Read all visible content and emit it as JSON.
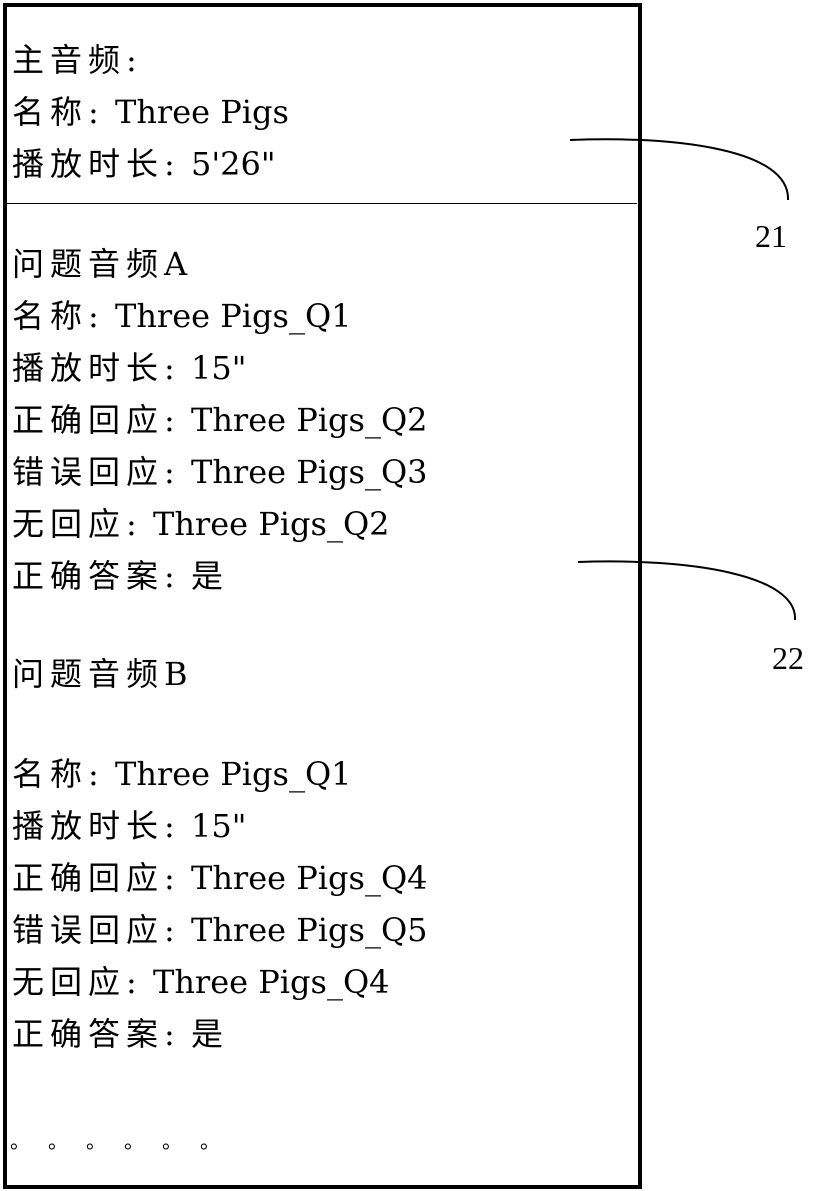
{
  "main_audio": {
    "heading": "主音频:",
    "name_label": "名称:",
    "name_value": "Three Pigs",
    "duration_label": "播放时长:",
    "duration_value": "5'26\""
  },
  "question_a": {
    "heading": "问题音频A",
    "name_label": "名称:",
    "name_value": "Three Pigs_Q1",
    "duration_label": "播放时长:",
    "duration_value": "15\"",
    "correct_response_label": "正确回应:",
    "correct_response_value": "Three Pigs_Q2",
    "wrong_response_label": "错误回应:",
    "wrong_response_value": "Three Pigs_Q3",
    "no_response_label": "无回应:",
    "no_response_value": "Three Pigs_Q2",
    "correct_answer_label": "正确答案:",
    "correct_answer_value": "是"
  },
  "question_b": {
    "heading": "问题音频B",
    "name_label": "名称:",
    "name_value": "Three Pigs_Q1",
    "duration_label": "播放时长:",
    "duration_value": "15\"",
    "correct_response_label": "正确回应:",
    "correct_response_value": "Three Pigs_Q4",
    "wrong_response_label": "错误回应:",
    "wrong_response_value": "Three Pigs_Q5",
    "no_response_label": "无回应:",
    "no_response_value": "Three Pigs_Q4",
    "correct_answer_label": "正确答案:",
    "correct_answer_value": "是"
  },
  "ellipsis": "。。。。。。",
  "references": {
    "ref_21": "21",
    "ref_22": "22"
  }
}
